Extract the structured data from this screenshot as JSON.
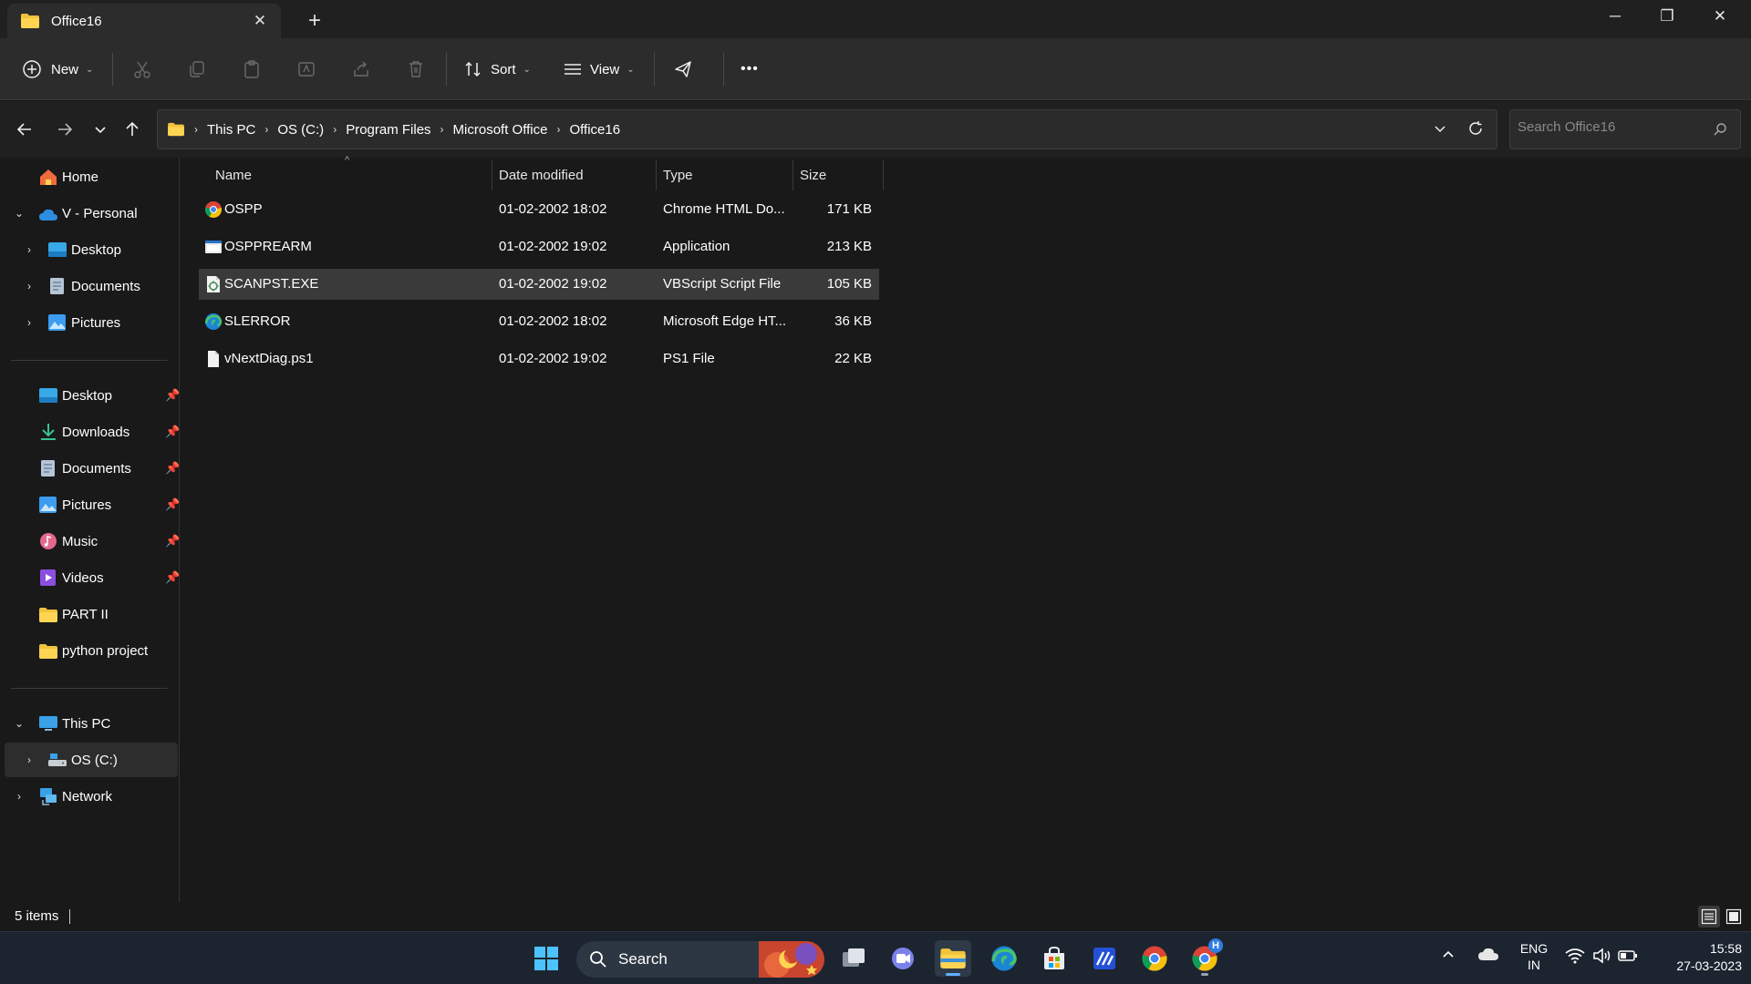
{
  "window": {
    "tab_title": "Office16",
    "tab_close": "✕",
    "new_tab": "+",
    "controls": {
      "minimize": "─",
      "maximize": "❐",
      "close": "✕"
    }
  },
  "toolbar": {
    "new_label": "New",
    "sort_label": "Sort",
    "view_label": "View",
    "more_label": "•••"
  },
  "address": {
    "breadcrumbs": [
      "This PC",
      "OS (C:)",
      "Program Files",
      "Microsoft Office",
      "Office16"
    ],
    "search_placeholder": "Search Office16"
  },
  "sidebar": {
    "home": "Home",
    "onedrive": "V - Personal",
    "onedrive_children": [
      "Desktop",
      "Documents",
      "Pictures"
    ],
    "quick_access": [
      "Desktop",
      "Downloads",
      "Documents",
      "Pictures",
      "Music",
      "Videos",
      "PART II",
      "python project"
    ],
    "this_pc": "This PC",
    "os_drive": "OS (C:)",
    "network": "Network"
  },
  "columns": {
    "name": "Name",
    "date": "Date modified",
    "type": "Type",
    "size": "Size"
  },
  "files": [
    {
      "name": "OSPP",
      "date": "01-02-2002 18:02",
      "type": "Chrome HTML Do...",
      "size": "171 KB",
      "icon": "chrome-html-icon"
    },
    {
      "name": "OSPPREARM",
      "date": "01-02-2002 19:02",
      "type": "Application",
      "size": "213 KB",
      "icon": "application-icon"
    },
    {
      "name": "SCANPST.EXE",
      "date": "01-02-2002 19:02",
      "type": "VBScript Script File",
      "size": "105 KB",
      "icon": "vbscript-icon"
    },
    {
      "name": "SLERROR",
      "date": "01-02-2002 18:02",
      "type": "Microsoft Edge HT...",
      "size": "36 KB",
      "icon": "edge-html-icon"
    },
    {
      "name": "vNextDiag.ps1",
      "date": "01-02-2002 19:02",
      "type": "PS1 File",
      "size": "22 KB",
      "icon": "generic-file-icon"
    }
  ],
  "status": {
    "item_count": "5 items"
  },
  "taskbar": {
    "search_label": "Search",
    "lang_top": "ENG",
    "lang_bottom": "IN",
    "time": "15:58",
    "date": "27-03-2023",
    "chrome_badge": "H"
  },
  "colors": {
    "accent": "#60b0ff",
    "folder": "#f0c33c",
    "selection": "#3a3a3a"
  }
}
